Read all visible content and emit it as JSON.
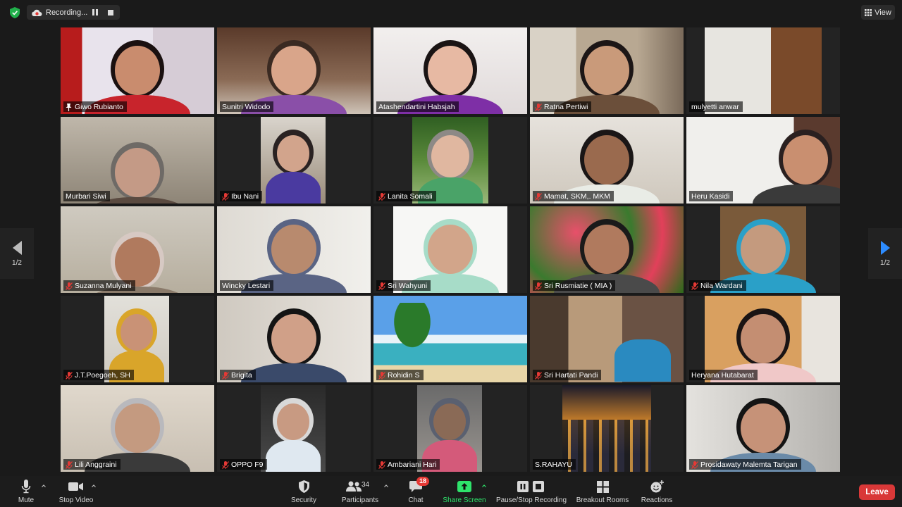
{
  "top": {
    "recording_label": "Recording...",
    "view_label": "View"
  },
  "pager": {
    "left_label": "1/2",
    "right_label": "1/2"
  },
  "participants": [
    {
      "name": "Giwo Rubianto",
      "muted": false,
      "pinned": true,
      "active": true
    },
    {
      "name": "Sunitri Widodo",
      "muted": false,
      "pinned": false,
      "active": false
    },
    {
      "name": "Atashendartini Habsjah",
      "muted": false,
      "pinned": false,
      "active": false
    },
    {
      "name": "Ratna Pertiwi",
      "muted": true,
      "pinned": false,
      "active": false
    },
    {
      "name": "mulyetti anwar",
      "muted": false,
      "pinned": false,
      "active": false
    },
    {
      "name": "Murbari Siwi",
      "muted": false,
      "pinned": false,
      "active": false
    },
    {
      "name": "Ibu Nani",
      "muted": true,
      "pinned": false,
      "active": false
    },
    {
      "name": "Lanita Somali",
      "muted": true,
      "pinned": false,
      "active": false
    },
    {
      "name": "Mamat, SKM,. MKM",
      "muted": true,
      "pinned": false,
      "active": false
    },
    {
      "name": "Heru Kasidi",
      "muted": false,
      "pinned": false,
      "active": false
    },
    {
      "name": "Suzanna Mulyani",
      "muted": true,
      "pinned": false,
      "active": false
    },
    {
      "name": "Wincky Lestari",
      "muted": false,
      "pinned": false,
      "active": false
    },
    {
      "name": "Sri Wahyuni",
      "muted": true,
      "pinned": false,
      "active": false
    },
    {
      "name": "Sri Rusmiatie ( MIA )",
      "muted": true,
      "pinned": false,
      "active": false
    },
    {
      "name": "Nila Wardani",
      "muted": true,
      "pinned": false,
      "active": false
    },
    {
      "name": "J.T.Poegoeh, SH",
      "muted": true,
      "pinned": false,
      "active": false
    },
    {
      "name": "Brigita",
      "muted": true,
      "pinned": false,
      "active": false
    },
    {
      "name": "Rohidin S",
      "muted": true,
      "pinned": false,
      "active": false
    },
    {
      "name": "Sri Hartati Pandi",
      "muted": true,
      "pinned": false,
      "active": false
    },
    {
      "name": "Heryana Hutabarat",
      "muted": false,
      "pinned": false,
      "active": false
    },
    {
      "name": "Lili Anggraini",
      "muted": true,
      "pinned": false,
      "active": false
    },
    {
      "name": "OPPO F9",
      "muted": true,
      "pinned": false,
      "active": false
    },
    {
      "name": "Ambariani Hari",
      "muted": true,
      "pinned": false,
      "active": false
    },
    {
      "name": "S.RAHAYU",
      "muted": false,
      "pinned": false,
      "active": false
    },
    {
      "name": "Prosidawaty Malemta Tarigan",
      "muted": true,
      "pinned": false,
      "active": false
    }
  ],
  "toolbar": {
    "mute": "Mute",
    "stop_video": "Stop Video",
    "security": "Security",
    "participants": "Participants",
    "participants_count": "34",
    "chat": "Chat",
    "chat_badge": "18",
    "share_screen": "Share Screen",
    "pause_recording": "Pause/Stop Recording",
    "breakout_rooms": "Breakout Rooms",
    "reactions": "Reactions",
    "leave": "Leave"
  },
  "colors": {
    "active_speaker_border": "#c9e26a",
    "share_green": "#2ee36b",
    "leave_red": "#d93838",
    "muted_red": "#e53935",
    "pager_arrow_blue": "#2d8cff"
  }
}
